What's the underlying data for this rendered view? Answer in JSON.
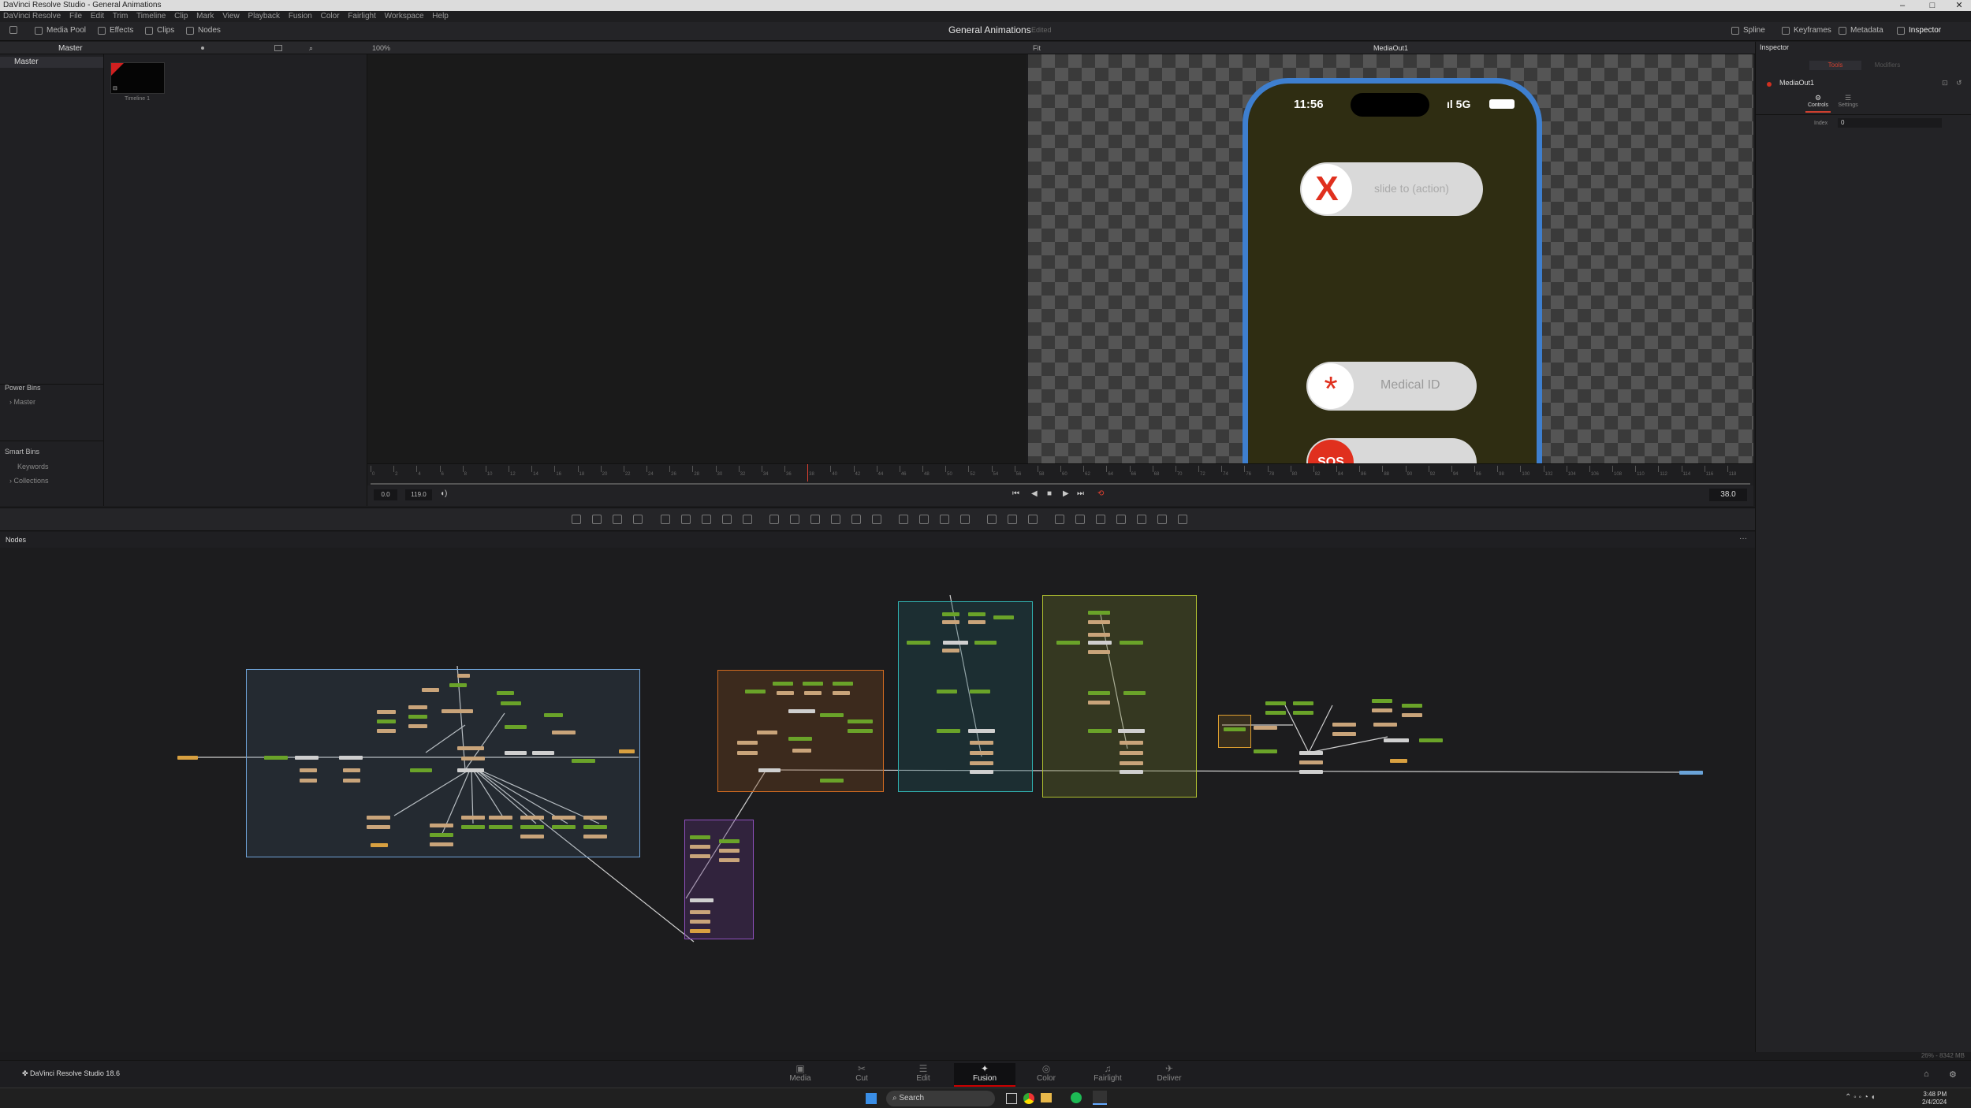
{
  "window": {
    "title": "DaVinci Resolve Studio - General Animations"
  },
  "menu": [
    "DaVinci Resolve",
    "File",
    "Edit",
    "Trim",
    "Timeline",
    "Clip",
    "Mark",
    "View",
    "Playback",
    "Fusion",
    "Color",
    "Fairlight",
    "Workspace",
    "Help"
  ],
  "toolbar": {
    "media_pool": "Media Pool",
    "effects": "Effects",
    "clips": "Clips",
    "nodes": "Nodes",
    "spline": "Spline",
    "keyframes": "Keyframes",
    "metadata": "Metadata",
    "inspector": "Inspector"
  },
  "project": {
    "title": "General Animations",
    "status": "Edited"
  },
  "media_pool": {
    "bin_header": "Master",
    "bin_master": "Master",
    "zoom": "100%",
    "clip_label": "Timeline 1"
  },
  "bins": {
    "power_bins": "Power Bins",
    "power_master": "Master",
    "smart_bins": "Smart Bins",
    "keywords": "Keywords",
    "collections": "Collections"
  },
  "viewer": {
    "fit": "Fit",
    "node_name": "MediaOut1"
  },
  "phone": {
    "time": "11:56",
    "signal": "5G",
    "slide_text": "slide to (action)",
    "medical_text": "Medical ID",
    "sos_text": "SOS",
    "colors": {
      "frame": "#3e7fcf",
      "screen": "#2f2d12",
      "pill": "#d9d9d9",
      "red": "#e0301e"
    }
  },
  "timeline": {
    "start": "0.0",
    "end": "119.0",
    "current": "38.0",
    "ticks": [
      "0",
      "2",
      "4",
      "6",
      "8",
      "10",
      "12",
      "14",
      "16",
      "18",
      "20",
      "22",
      "24",
      "26",
      "28",
      "30",
      "32",
      "34",
      "36",
      "38",
      "40",
      "42",
      "44",
      "46",
      "48",
      "50",
      "52",
      "54",
      "56",
      "58",
      "60",
      "62",
      "64",
      "66",
      "68",
      "70",
      "72",
      "74",
      "76",
      "78",
      "80",
      "82",
      "84",
      "86",
      "88",
      "90",
      "92",
      "94",
      "96",
      "98",
      "100",
      "102",
      "104",
      "106",
      "108",
      "110",
      "112",
      "114",
      "116",
      "118"
    ]
  },
  "nodes_panel": {
    "title": "Nodes"
  },
  "inspector": {
    "title": "Inspector",
    "tabs": [
      "Tools",
      "Modifiers"
    ],
    "node": "MediaOut1",
    "sub_tabs": [
      "Controls",
      "Settings"
    ],
    "index_label": "Index",
    "index_value": "0"
  },
  "status": {
    "memory": "26% - 8342 MB"
  },
  "app": {
    "name": "DaVinci Resolve Studio 18.6"
  },
  "pages": [
    "Media",
    "Cut",
    "Edit",
    "Fusion",
    "Color",
    "Fairlight",
    "Deliver"
  ],
  "active_page": "Fusion",
  "taskbar": {
    "search": "Search",
    "time": "3:48 PM",
    "date": "2/4/2024"
  }
}
